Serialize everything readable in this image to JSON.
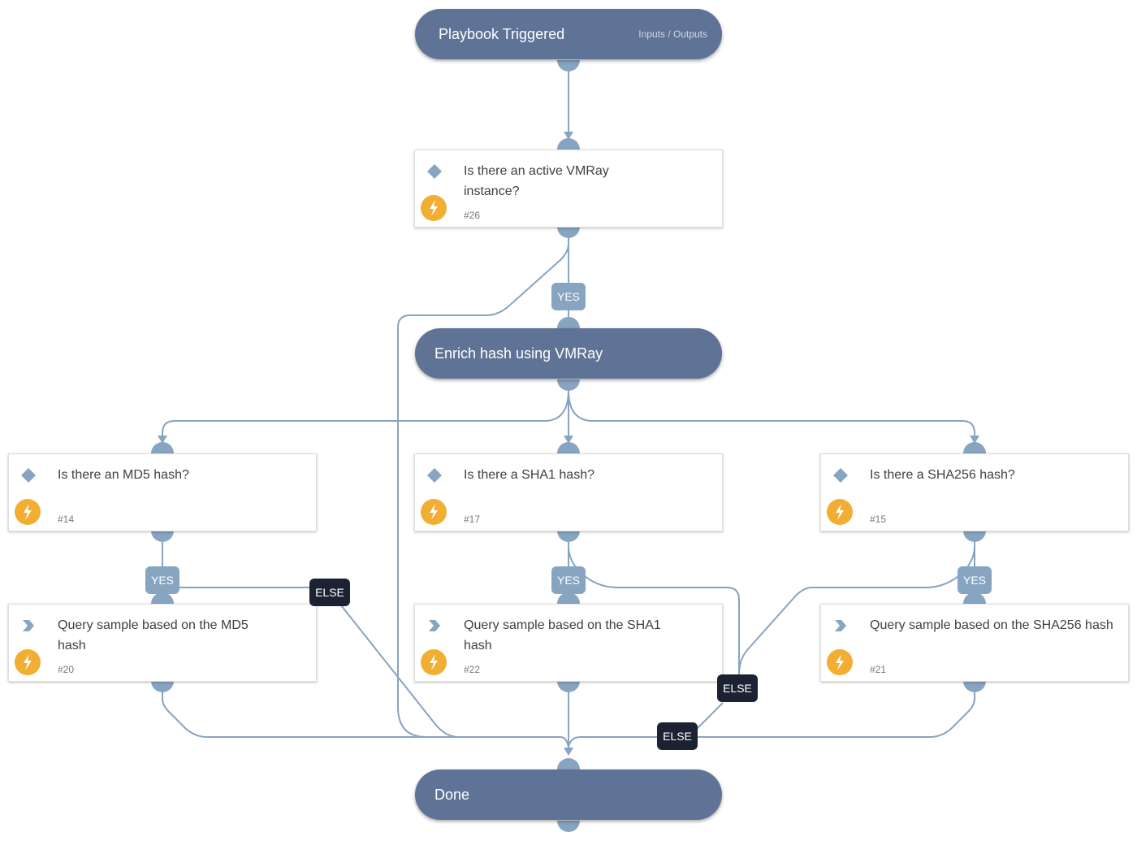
{
  "colors": {
    "pill_bg": "#5f7396",
    "edge": "#87a4c1",
    "automation_badge": "#f1ae33",
    "else_label_bg": "#1b2333",
    "yes_label_bg": "#87a4c1"
  },
  "nodes": {
    "start": {
      "title": "Playbook Triggered",
      "io_link": "Inputs / Outputs"
    },
    "check_instance": {
      "title": "Is there an active VMRay instance?",
      "id": "#26",
      "type": "condition-icon"
    },
    "enrich": {
      "title": "Enrich hash using VMRay"
    },
    "check_md5": {
      "title": "Is there an MD5 hash?",
      "id": "#14",
      "type": "condition-icon"
    },
    "check_sha1": {
      "title": "Is there a SHA1 hash?",
      "id": "#17",
      "type": "condition-icon"
    },
    "check_sha256": {
      "title": "Is there a SHA256 hash?",
      "id": "#15",
      "type": "condition-icon"
    },
    "query_md5": {
      "title": "Query sample based on the MD5 hash",
      "id": "#20",
      "type": "action-icon"
    },
    "query_sha1": {
      "title": "Query sample based on the SHA1 hash",
      "id": "#22",
      "type": "action-icon"
    },
    "query_sha256": {
      "title": "Query sample based on the SHA256 hash",
      "id": "#21",
      "type": "action-icon"
    },
    "done": {
      "title": "Done"
    }
  },
  "labels": {
    "yes": "YES",
    "else": "ELSE"
  }
}
